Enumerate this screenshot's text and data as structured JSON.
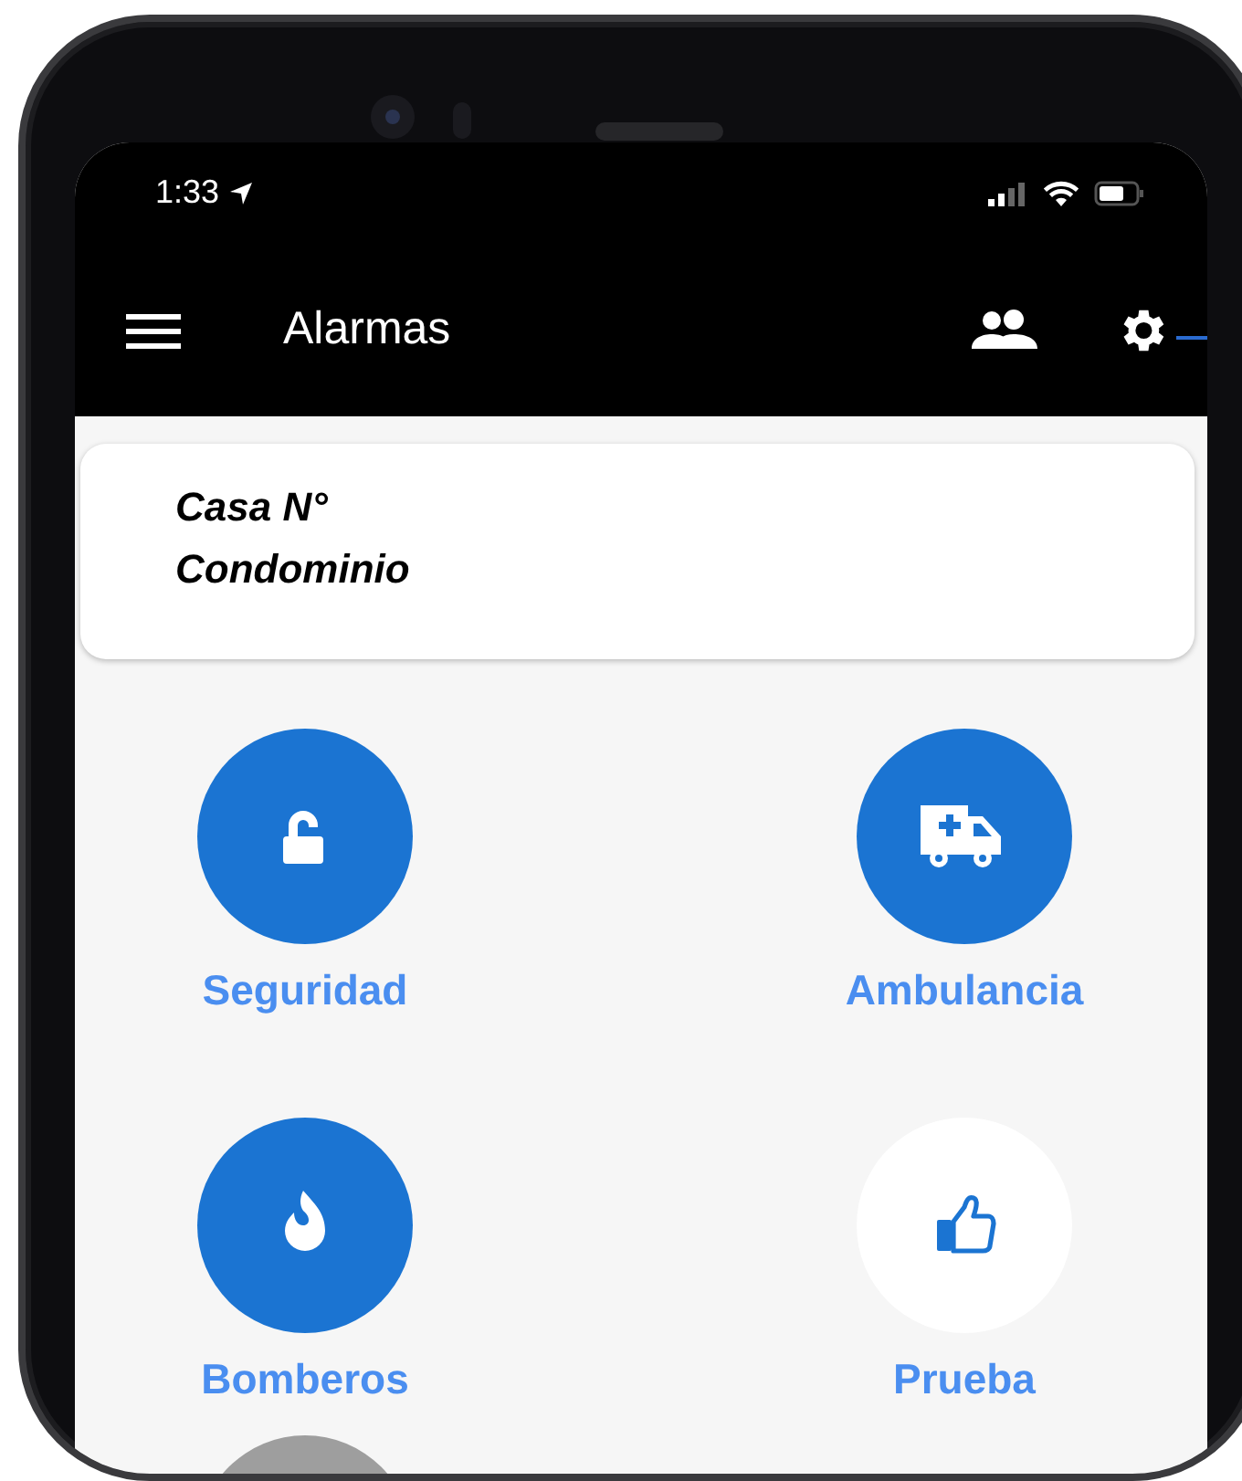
{
  "status_bar": {
    "time": "1:33"
  },
  "app_bar": {
    "title": "Alarmas"
  },
  "card": {
    "lines": [
      "Casa N°",
      "Condominio"
    ]
  },
  "alarms": [
    {
      "kind": "filled",
      "label": "Seguridad"
    },
    {
      "kind": "filled",
      "label": "Ambulancia"
    },
    {
      "kind": "filled",
      "label": "Bomberos"
    },
    {
      "kind": "plain",
      "label": "Prueba"
    },
    {
      "kind": "muted"
    }
  ]
}
